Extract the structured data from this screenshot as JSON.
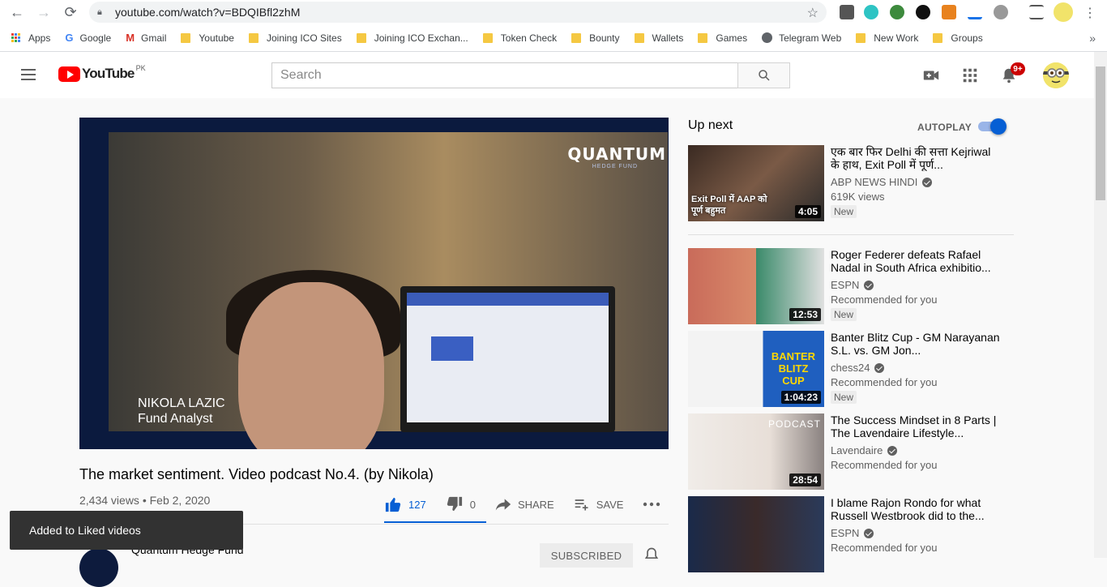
{
  "browser": {
    "url": "youtube.com/watch?v=BDQIBfl2zhM",
    "bookmarks": [
      {
        "label": "Apps",
        "icon": "apps-grid-icon"
      },
      {
        "label": "Google",
        "icon": "google-icon"
      },
      {
        "label": "Gmail",
        "icon": "gmail-icon"
      },
      {
        "label": "Youtube",
        "icon": "folder-icon"
      },
      {
        "label": "Joining ICO Sites",
        "icon": "folder-icon"
      },
      {
        "label": "Joining ICO Exchan...",
        "icon": "folder-icon"
      },
      {
        "label": "Token Check",
        "icon": "folder-icon"
      },
      {
        "label": "Bounty",
        "icon": "folder-icon"
      },
      {
        "label": "Wallets",
        "icon": "folder-icon"
      },
      {
        "label": "Games",
        "icon": "folder-icon"
      },
      {
        "label": "Telegram Web",
        "icon": "globe-icon"
      },
      {
        "label": "New Work",
        "icon": "folder-icon"
      },
      {
        "label": "Groups",
        "icon": "folder-icon"
      }
    ],
    "more": "»"
  },
  "header": {
    "logo_word": "YouTube",
    "country": "PK",
    "search_placeholder": "Search",
    "notification_count": "9+"
  },
  "player": {
    "watermark": "QUANTUM",
    "watermark_sub": "HEDGE FUND",
    "lower_third_name": "NIKOLA LAZIC",
    "lower_third_role": "Fund Analyst"
  },
  "video": {
    "title": "The market sentiment. Video podcast No.4. (by Nikola)",
    "meta": "2,434 views • Feb 2, 2020",
    "likes": "127",
    "dislikes": "0",
    "share_label": "SHARE",
    "save_label": "SAVE"
  },
  "channel": {
    "name": "Quantum Hedge Fund",
    "subscribe_label": "SUBSCRIBED"
  },
  "toast": "Added to Liked videos",
  "sidebar": {
    "upnext": "Up next",
    "autoplay": "AUTOPLAY",
    "autoplay_on": true,
    "items": [
      {
        "title": "एक बार फिर Delhi की सत्ता Kejriwal के हाथ, Exit Poll में पूर्ण...",
        "channel": "ABP NEWS HINDI",
        "sub": "619K views",
        "badge": "New",
        "duration": "4:05",
        "thumb_text": "Exit Poll में AAP को पूर्ण बहुमत"
      },
      {
        "title": "Roger Federer defeats Rafael Nadal in South Africa exhibitio...",
        "channel": "ESPN",
        "sub": "Recommended for you",
        "badge": "New",
        "duration": "12:53"
      },
      {
        "title": "Banter Blitz Cup - GM Narayanan S.L. vs. GM Jon...",
        "channel": "chess24",
        "sub": "Recommended for you",
        "badge": "New",
        "duration": "1:04:23",
        "thumb_text": "BANTER BLITZ CUP"
      },
      {
        "title": "The Success Mindset in 8 Parts | The Lavendaire Lifestyle...",
        "channel": "Lavendaire",
        "sub": "Recommended for you",
        "badge": "",
        "duration": "28:54",
        "thumb_text": "PODCAST"
      },
      {
        "title": "I blame Rajon Rondo for what Russell Westbrook did to the...",
        "channel": "ESPN",
        "sub": "Recommended for you",
        "badge": "",
        "duration": ""
      }
    ]
  }
}
